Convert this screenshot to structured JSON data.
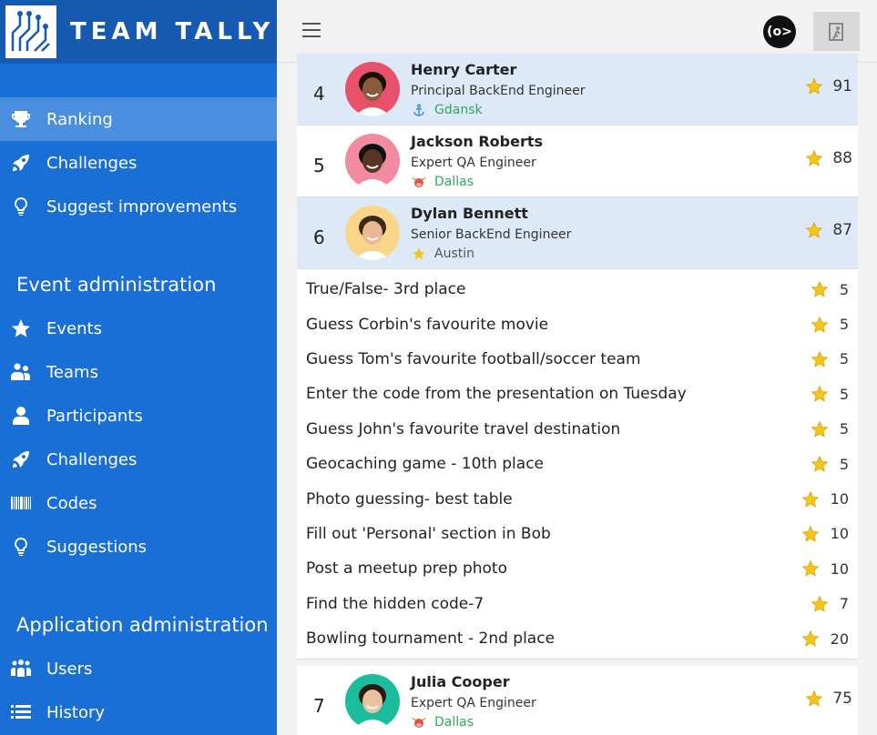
{
  "brand": {
    "name": "TEAM TALLY"
  },
  "sidebar": {
    "main_items": [
      {
        "label": "Ranking",
        "icon": "trophy-icon",
        "active": true
      },
      {
        "label": "Challenges",
        "icon": "rocket-icon",
        "active": false
      },
      {
        "label": "Suggest improvements",
        "icon": "lightbulb-icon",
        "active": false
      }
    ],
    "event_admin_title": "Event administration",
    "event_items": [
      {
        "label": "Events",
        "icon": "star-icon"
      },
      {
        "label": "Teams",
        "icon": "team-icon"
      },
      {
        "label": "Participants",
        "icon": "user-icon"
      },
      {
        "label": "Challenges",
        "icon": "rocket-icon"
      },
      {
        "label": "Codes",
        "icon": "barcode-icon"
      },
      {
        "label": "Suggestions",
        "icon": "lightbulb-icon"
      }
    ],
    "app_admin_title": "Application administration",
    "app_items": [
      {
        "label": "Users",
        "icon": "users-icon"
      },
      {
        "label": "History",
        "icon": "list-icon"
      }
    ]
  },
  "topbar": {
    "company_logo_text": "(o>"
  },
  "ranking": [
    {
      "rank": "4",
      "name": "Henry Carter",
      "title": "Principal BackEnd Engineer",
      "location": "Gdansk",
      "location_icon": "anchor-icon",
      "location_color": "#2eaa5a",
      "score": "91",
      "highlight": true
    },
    {
      "rank": "5",
      "name": "Jackson Roberts",
      "title": "Expert QA Engineer",
      "location": "Dallas",
      "location_icon": "bull-icon",
      "location_color": "#2eaa5a",
      "score": "88",
      "highlight": false
    },
    {
      "rank": "6",
      "name": "Dylan Bennett",
      "title": "Senior BackEnd Engineer",
      "location": "Austin",
      "location_icon": "star-icon",
      "location_color": "#555555",
      "score": "87",
      "highlight": true
    }
  ],
  "challenges": [
    {
      "name": "True/False- 3rd place",
      "points": "5"
    },
    {
      "name": "Guess Corbin's favourite movie",
      "points": "5"
    },
    {
      "name": "Guess Tom's favourite football/soccer team",
      "points": "5"
    },
    {
      "name": "Enter the code from the presentation on Tuesday",
      "points": "5"
    },
    {
      "name": "Guess John's favourite travel destination",
      "points": "5"
    },
    {
      "name": "Geocaching game - 10th place",
      "points": "5"
    },
    {
      "name": "Photo guessing- best table",
      "points": "10"
    },
    {
      "name": "Fill out 'Personal' section in Bob",
      "points": "10"
    },
    {
      "name": "Post a meetup prep photo",
      "points": "10"
    },
    {
      "name": "Find the hidden code-7",
      "points": "7"
    },
    {
      "name": "Bowling tournament - 2nd place",
      "points": "20"
    }
  ],
  "ranking_after": [
    {
      "rank": "7",
      "name": "Julia Cooper",
      "title": "Expert QA Engineer",
      "location": "Dallas",
      "location_icon": "bull-icon",
      "location_color": "#2eaa5a",
      "score": "75",
      "highlight": false
    }
  ],
  "colors": {
    "sidebar": "#1a6fd6",
    "brand_bar": "#1559b0",
    "active_item": "#4a8ee0",
    "highlight_row": "#dde9f7",
    "star": "#f5c518"
  }
}
